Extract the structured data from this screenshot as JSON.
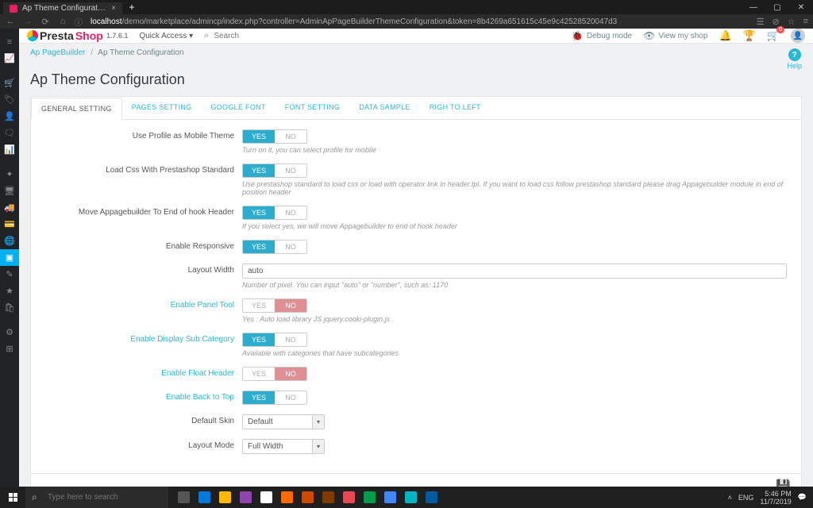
{
  "browser": {
    "tab_title": "Ap Theme Configuration • m",
    "url_prefix": "localhost",
    "url_rest": "/demo/marketplace/admincp/index.php?controller=AdminApPageBuilderThemeConfiguration&token=8b4269a651615c45e9c42528520047d3"
  },
  "topbar": {
    "brand_a": "Presta",
    "brand_b": "Shop",
    "version": "1.7.6.1",
    "quick_access": "Quick Access ▾",
    "search_placeholder": "Search",
    "debug": "Debug mode",
    "view_shop": "View my shop",
    "cart_badge": "0"
  },
  "breadcrumb": {
    "a": "Ap PageBuilder",
    "b": "Ap Theme Configuration"
  },
  "page_title": "Ap Theme Configuration",
  "help_label": "Help",
  "tabs": [
    "GENERAL SETTING",
    "PAGES SETTING",
    "GOOGLE FONT",
    "FONT SETTING",
    "DATA SAMPLE",
    "RIGH TO LEFT"
  ],
  "toggle_labels": {
    "yes": "YES",
    "no": "NO"
  },
  "rows": [
    {
      "label": "Use Profile as Mobile Theme",
      "state": "yes",
      "hint": "Turn on it, you can select profile for mobile",
      "link": false
    },
    {
      "label": "Load Css With Prestashop Standard",
      "state": "yes",
      "hint": "Use prestashop standard to load css or load with operator link in header.tpl. If you want to load css follow prestashop standard please drag Appagebuilder module in end of position header",
      "link": false
    },
    {
      "label": "Move Appagebuilder To End of hook Header",
      "state": "yes",
      "hint": "If you select yes, we will move Appagebuilder to end of hook header",
      "link": false
    },
    {
      "label": "Enable Responsive",
      "state": "yes",
      "hint": "",
      "link": false
    }
  ],
  "layout_width": {
    "label": "Layout Width",
    "value": "auto",
    "hint": "Number of pixel. You can input \"auto\" or \"number\", such as: 1170"
  },
  "rows2": [
    {
      "label": "Enable Panel Tool",
      "state": "no",
      "hint": "Yes : Auto load library JS jquery.cooki-plugin.js",
      "link": true
    },
    {
      "label": "Enable Display Sub Category",
      "state": "yes",
      "hint": "Available with categories that have subcategories",
      "link": true
    },
    {
      "label": "Enable Float Header",
      "state": "no",
      "hint": "",
      "link": true
    },
    {
      "label": "Enable Back to Top",
      "state": "yes",
      "hint": "",
      "link": true
    }
  ],
  "selects": [
    {
      "label": "Default Skin",
      "value": "Default"
    },
    {
      "label": "Layout Mode",
      "value": "Full Width"
    }
  ],
  "save_label": "Save",
  "taskbar": {
    "search_placeholder": "Type here to search",
    "time": "5:46 PM",
    "date": "11/7/2019",
    "lang": "ENG",
    "up": "˄"
  },
  "task_colors": [
    "#555",
    "#0078d7",
    "#ffb900",
    "#8e44ad",
    "#fff",
    "#ff6a00",
    "#cc4b00",
    "#7f3a00",
    "#e74856",
    "#009e49",
    "#4285f4",
    "#00b7c3",
    "#005a9e"
  ]
}
